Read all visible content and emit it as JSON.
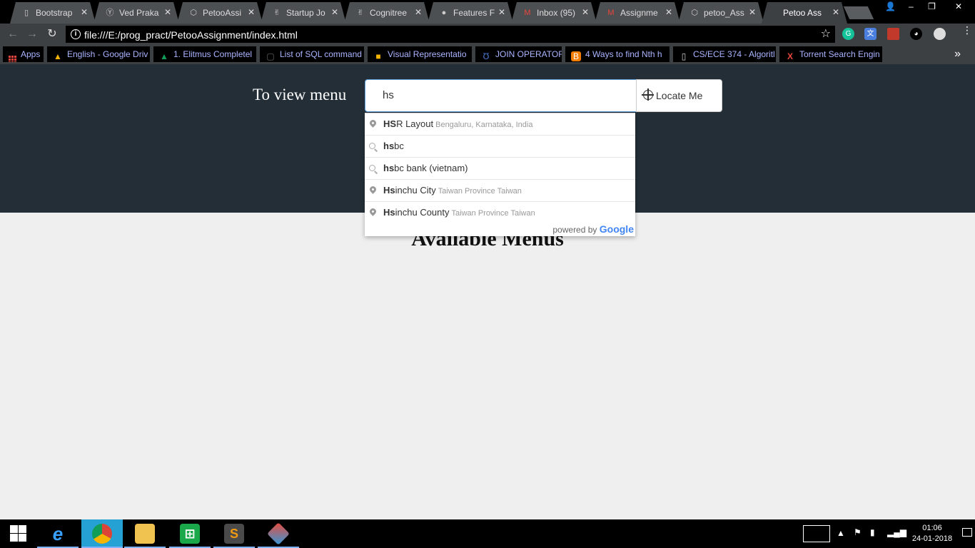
{
  "tabs": [
    {
      "title": "Bootstrap",
      "icon": "page-icon"
    },
    {
      "title": "Ved Praka",
      "icon": "y-icon"
    },
    {
      "title": "PetooAssi",
      "icon": "codepen-icon"
    },
    {
      "title": "Startup Jo",
      "icon": "angellist-icon"
    },
    {
      "title": "Cognitree",
      "icon": "angellist-icon"
    },
    {
      "title": "Features F",
      "icon": "github-icon"
    },
    {
      "title": "Inbox (95)",
      "icon": "gmail-icon"
    },
    {
      "title": "Assignme",
      "icon": "gmail-icon"
    },
    {
      "title": "petoo_Ass",
      "icon": "codepen-icon"
    },
    {
      "title": "Petoo Ass",
      "icon": "page-icon",
      "active": true
    }
  ],
  "window": {
    "min": "–",
    "max": "❐",
    "close": "✕"
  },
  "address_bar": {
    "url": "file:///E:/prog_pract/PetooAssignment/index.html"
  },
  "bookmarks": [
    {
      "label": "Apps",
      "icon": "apps-grid-icon"
    },
    {
      "label": "English - Google Driv",
      "icon": "drive-icon"
    },
    {
      "label": "1. Elitmus Completel",
      "icon": "drive-icon"
    },
    {
      "label": "List of SQL command",
      "icon": "sql-icon"
    },
    {
      "label": "Visual Representatio",
      "icon": "visual-icon"
    },
    {
      "label": "JOIN OPERATOR",
      "icon": "ud-icon"
    },
    {
      "label": "4 Ways to find Nth h",
      "icon": "blogger-icon"
    },
    {
      "label": "CS/ECE 374 - Algoritl",
      "icon": "doc-icon"
    },
    {
      "label": "Torrent Search Engin",
      "icon": "torrent-icon"
    }
  ],
  "hero": {
    "label": "To view menu",
    "search_value": "hs",
    "locate_label": "Locate Me"
  },
  "autocomplete": [
    {
      "match": "HS",
      "rest": "R Layout",
      "secondary": "Bengaluru, Karnataka, India",
      "icon": "pin"
    },
    {
      "match": "hs",
      "rest": "bc",
      "secondary": "",
      "icon": "search"
    },
    {
      "match": "hs",
      "rest": "bc bank (vietnam)",
      "secondary": "",
      "icon": "search"
    },
    {
      "match": "Hs",
      "rest": "inchu City",
      "secondary": "Taiwan Province Taiwan",
      "icon": "pin"
    },
    {
      "match": "Hs",
      "rest": "inchu County",
      "secondary": "Taiwan Province Taiwan",
      "icon": "pin"
    }
  ],
  "powered_by": "powered by",
  "google_word": "Google",
  "section_title": "Available Menus",
  "taskbar": {
    "time": "01:06",
    "date": "24-01-2018"
  },
  "colors": {
    "hero_bg": "#232e37",
    "page_bg": "#efefef",
    "taskbar_active": "#25a1d4"
  }
}
